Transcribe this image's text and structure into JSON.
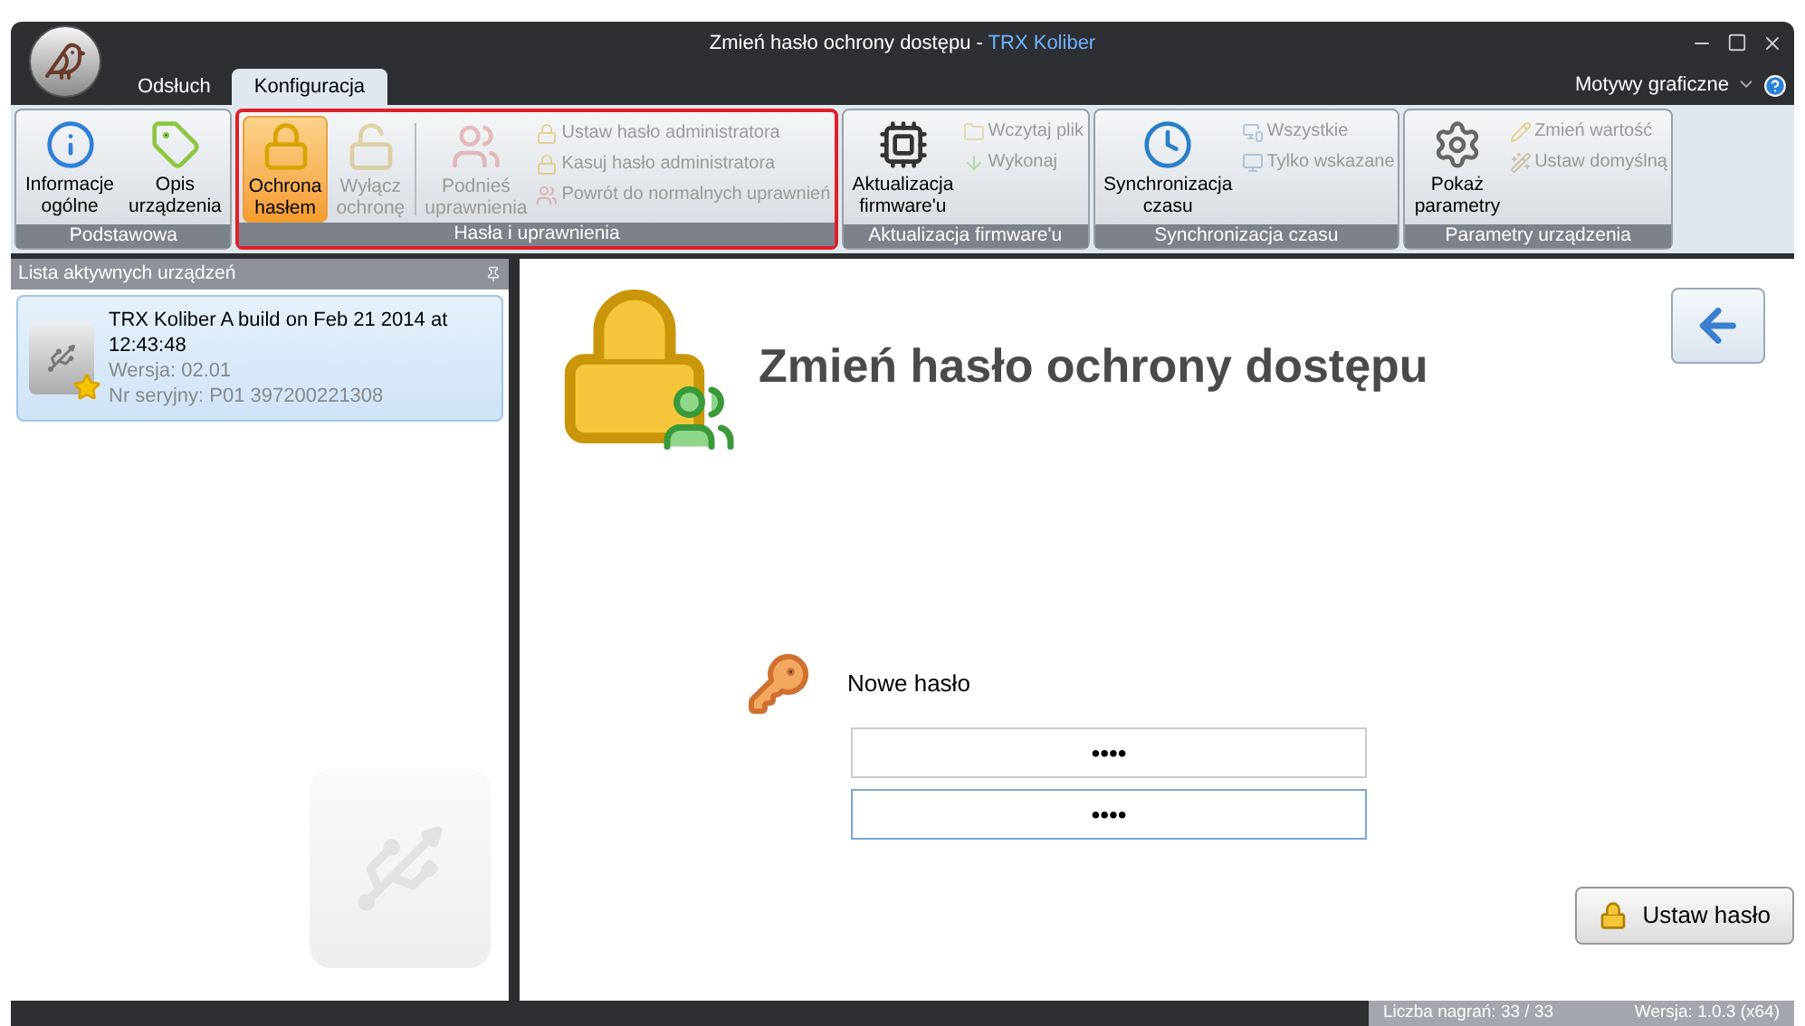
{
  "window": {
    "title": "Zmień hasło ochrony dostępu -",
    "app_name": "TRX Koliber"
  },
  "tabs": [
    {
      "label": "Odsłuch",
      "selected": false
    },
    {
      "label": "Konfiguracja",
      "selected": true
    }
  ],
  "themes_menu": {
    "label": "Motywy graficzne"
  },
  "ribbon": {
    "groups": [
      {
        "title": "Podstawowa",
        "highlighted": false,
        "items": [
          {
            "kind": "large",
            "label": "Informacje\nogólne",
            "disabled": false,
            "selected": false
          },
          {
            "kind": "large",
            "label": "Opis\nurządzenia",
            "disabled": false,
            "selected": false
          }
        ]
      },
      {
        "title": "Hasła i uprawnienia",
        "highlighted": true,
        "items": [
          {
            "kind": "large",
            "label": "Ochrona\nhasłem",
            "disabled": false,
            "selected": true
          },
          {
            "kind": "large",
            "label": "Wyłącz\nochronę",
            "disabled": true,
            "selected": false
          },
          {
            "kind": "separator"
          },
          {
            "kind": "large",
            "label": "Podnieś\nuprawnienia",
            "disabled": true,
            "selected": false
          },
          {
            "kind": "small",
            "label": "Ustaw hasło administratora",
            "disabled": true
          },
          {
            "kind": "small",
            "label": "Kasuj hasło administratora",
            "disabled": true
          },
          {
            "kind": "small",
            "label": "Powrót do normalnych uprawnień",
            "disabled": true
          }
        ]
      },
      {
        "title": "Aktualizacja firmware'u",
        "highlighted": false,
        "items": [
          {
            "kind": "large",
            "label": "Aktualizacja\nfirmware'u",
            "disabled": false,
            "selected": false
          },
          {
            "kind": "small",
            "label": "Wczytaj plik",
            "disabled": true
          },
          {
            "kind": "small",
            "label": "Wykonaj",
            "disabled": true
          }
        ]
      },
      {
        "title": "Synchronizacja czasu",
        "highlighted": false,
        "items": [
          {
            "kind": "large",
            "label": "Synchronizacja\nczasu",
            "disabled": false,
            "selected": false
          },
          {
            "kind": "small",
            "label": "Wszystkie",
            "disabled": true
          },
          {
            "kind": "small",
            "label": "Tylko wskazane",
            "disabled": true
          }
        ]
      },
      {
        "title": "Parametry urządzenia",
        "highlighted": false,
        "items": [
          {
            "kind": "large",
            "label": "Pokaż\nparametry",
            "disabled": false,
            "selected": false
          },
          {
            "kind": "small",
            "label": "Zmień wartość",
            "disabled": true
          },
          {
            "kind": "small",
            "label": "Ustaw domyślną",
            "disabled": true
          }
        ]
      }
    ]
  },
  "sidebar": {
    "title": "Lista aktywnych urządzeń",
    "devices": [
      {
        "name": "TRX Koliber A build on Feb 21 2014 at 12:43:48",
        "version": "Wersja: 02.01",
        "serial": "Nr seryjny: P01 397200221308",
        "selected": true
      }
    ]
  },
  "main": {
    "heading": "Zmień hasło ochrony dostępu",
    "field_label": "Nowe hasło",
    "fields": [
      {
        "value": "••••"
      },
      {
        "value": "••••"
      }
    ],
    "button": "Ustaw hasło"
  },
  "status_bar": {
    "recordings": "Liczba nagrań: 33 / 33",
    "version": "Wersja: 1.0.3 (x64)"
  }
}
